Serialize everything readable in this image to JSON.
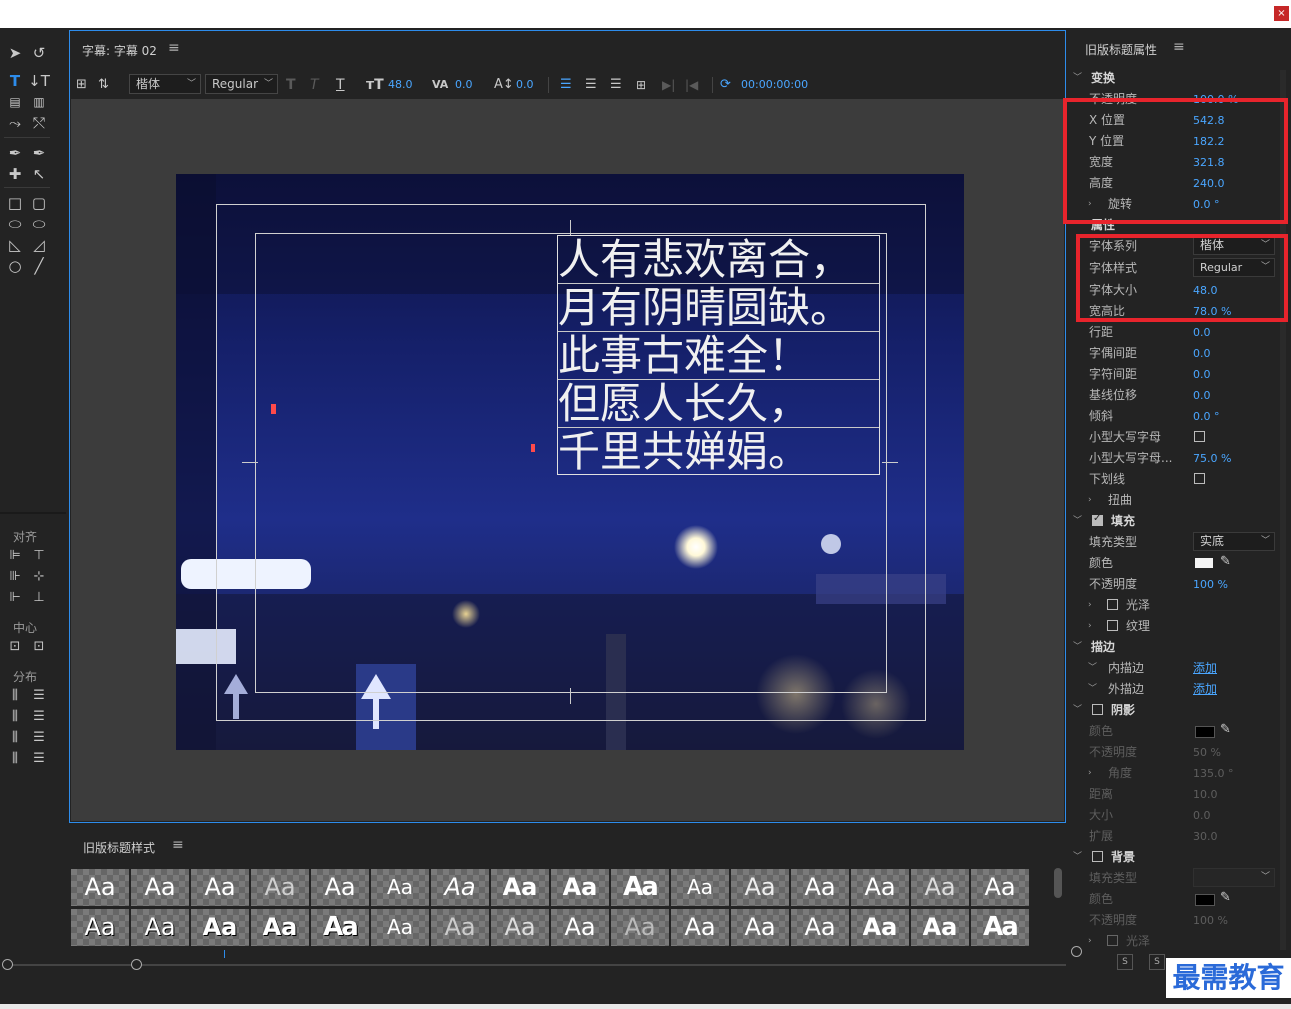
{
  "window": {
    "close": "×"
  },
  "tools": {
    "align_label": "对齐",
    "center_label": "中心",
    "distribute_label": "分布"
  },
  "editor": {
    "title": "字幕: 字幕 02",
    "menu": "≡",
    "font_family": "楷体",
    "font_style": "Regular",
    "font_size": "48.0",
    "kerning": "0.0",
    "leading": "0.0",
    "timecode": "00:00:00:00",
    "caption_lines": [
      "人有悲欢离合，",
      "月有阴晴圆缺。",
      "此事古难全！",
      "但愿人长久，",
      "千里共婵娟。"
    ]
  },
  "styles_panel": {
    "title": "旧版标题样式",
    "menu": "≡",
    "swatch_text": "Aa"
  },
  "props": {
    "title": "旧版标题属性",
    "menu": "≡",
    "transform": "变换",
    "opacity": "不透明度",
    "opacity_val": "100.0 %",
    "x_pos": "X 位置",
    "x_val": "542.8",
    "y_pos": "Y 位置",
    "y_val": "182.2",
    "width": "宽度",
    "width_val": "321.8",
    "height": "高度",
    "height_val": "240.0",
    "rotation": "旋转",
    "rotation_val": "0.0 °",
    "attributes": "属性",
    "font_family": "字体系列",
    "font_family_val": "楷体",
    "font_style": "字体样式",
    "font_style_val": "Regular",
    "font_size": "字体大小",
    "font_size_val": "48.0",
    "aspect": "宽高比",
    "aspect_val": "78.0 %",
    "leading": "行距",
    "leading_val": "0.0",
    "kerning": "字偶间距",
    "kerning_val": "0.0",
    "tracking": "字符间距",
    "tracking_val": "0.0",
    "baseline": "基线位移",
    "baseline_val": "0.0",
    "slant": "倾斜",
    "slant_val": "0.0 °",
    "small_caps": "小型大写字母",
    "small_caps_size": "小型大写字母...",
    "small_caps_size_val": "75.0 %",
    "underline": "下划线",
    "distort": "扭曲",
    "fill": "填充",
    "fill_type": "填充类型",
    "fill_type_val": "实底",
    "color": "颜色",
    "fill_opacity": "不透明度",
    "fill_opacity_val": "100 %",
    "sheen": "光泽",
    "texture": "纹理",
    "strokes": "描边",
    "inner_stroke": "内描边",
    "outer_stroke": "外描边",
    "add": "添加",
    "shadow": "阴影",
    "shadow_color": "颜色",
    "shadow_opacity": "不透明度",
    "shadow_opacity_val": "50 %",
    "angle": "角度",
    "angle_val": "135.0 °",
    "distance": "距离",
    "distance_val": "10.0",
    "size": "大小",
    "size_val": "0.0",
    "spread": "扩展",
    "spread_val": "30.0",
    "background": "背景",
    "bg_fill_type": "填充类型",
    "bg_color": "颜色",
    "bg_opacity": "不透明度",
    "bg_opacity_val": "100 %",
    "bg_sheen": "光泽"
  },
  "watermark": "最需教育",
  "colors": {
    "accent": "#2d8ceb",
    "value_blue": "#4aa6ff",
    "highlight_red": "#e8242c"
  }
}
